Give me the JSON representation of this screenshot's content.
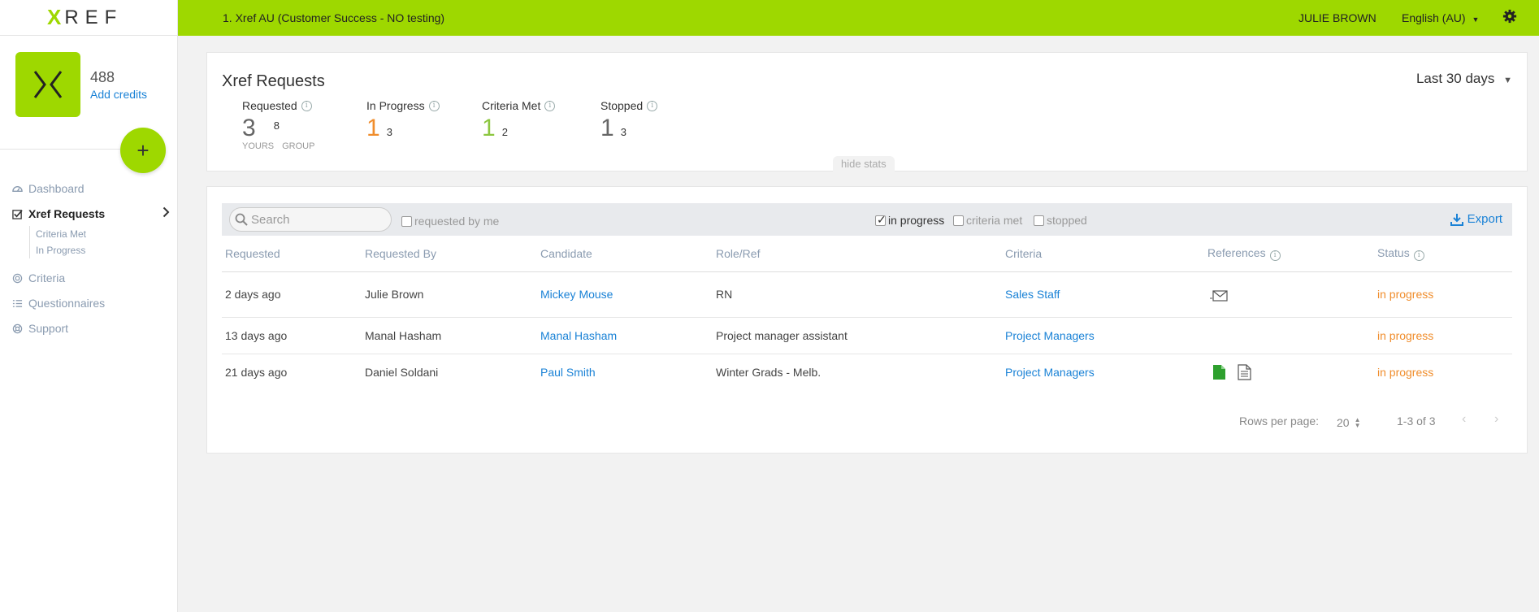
{
  "brand": {
    "logo_x": "X",
    "logo_word": "REF",
    "accent": "#9ed800"
  },
  "topbar": {
    "account": "1. Xref AU (Customer Success - NO testing)",
    "user": "JULIE BROWN",
    "language": "English (AU)"
  },
  "sidebar": {
    "credits": "488",
    "add_credits": "Add credits",
    "add_button": "+",
    "nav": {
      "dashboard": "Dashboard",
      "requests": "Xref Requests",
      "criteria_met": "Criteria Met",
      "in_progress": "In Progress",
      "criteria": "Criteria",
      "questionnaires": "Questionnaires",
      "support": "Support"
    }
  },
  "stats": {
    "title": "Xref Requests",
    "period": "Last 30 days",
    "requested": {
      "label": "Requested",
      "yours": "3",
      "group": "8",
      "yours_label": "YOURS",
      "group_label": "GROUP"
    },
    "in_progress": {
      "label": "In Progress",
      "big": "1",
      "small": "3",
      "color": "#f08d2c"
    },
    "criteria_met": {
      "label": "Criteria Met",
      "big": "1",
      "small": "2",
      "color": "#8cc63f"
    },
    "stopped": {
      "label": "Stopped",
      "big": "1",
      "small": "3",
      "color": "#666666"
    },
    "hide_stats": "hide stats"
  },
  "table": {
    "search_placeholder": "Search",
    "filters": {
      "requested_by_me": "requested by me",
      "in_progress": "in progress",
      "criteria_met": "criteria met",
      "stopped": "stopped"
    },
    "export": "Export",
    "headers": [
      "Requested",
      "Requested By",
      "Candidate",
      "Role/Ref",
      "Criteria",
      "References",
      "Status"
    ],
    "rows": [
      {
        "requested": "2 days ago",
        "by": "Julie Brown",
        "candidate": "Mickey Mouse",
        "role": "RN",
        "criteria": "Sales Staff",
        "refs": "email-icon",
        "status": "in progress"
      },
      {
        "requested": "13 days ago",
        "by": "Manal Hasham",
        "candidate": "Manal Hasham",
        "role": "Project manager assistant",
        "criteria": "Project Managers",
        "refs": "",
        "status": "in progress"
      },
      {
        "requested": "21 days ago",
        "by": "Daniel Soldani",
        "candidate": "Paul Smith",
        "role": "Winter Grads - Melb.",
        "criteria": "Project Managers",
        "refs": "document-icons",
        "status": "in progress"
      }
    ],
    "rows_per_page_label": "Rows per page:",
    "rows_per_page": "20",
    "range": "1-3 of 3",
    "prev": "‹",
    "next": "›"
  }
}
